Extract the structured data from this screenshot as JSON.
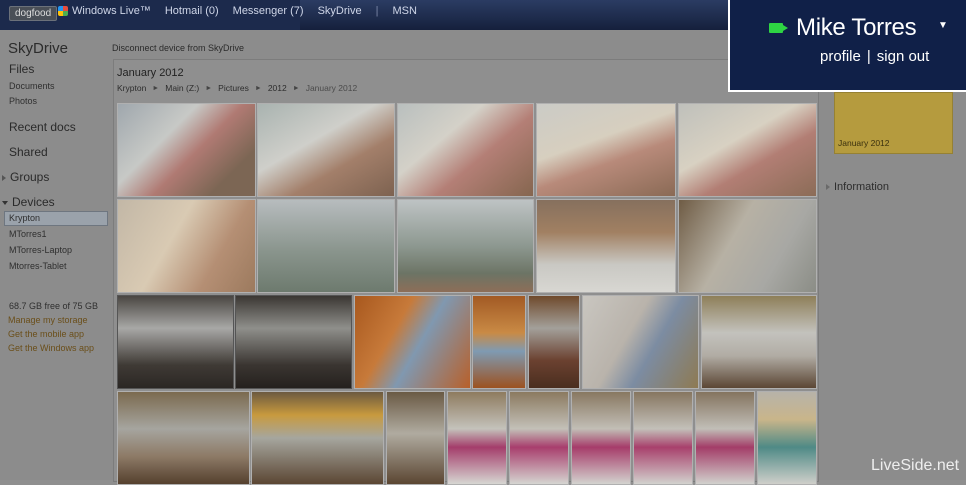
{
  "topnav": {
    "env_badge": "dogfood",
    "brand": "Windows Live™",
    "items": [
      "Hotmail (0)",
      "Messenger (7)",
      "SkyDrive",
      "|",
      "MSN"
    ]
  },
  "user": {
    "name": "Mike Torres",
    "profile": "profile",
    "signout": "sign out",
    "divider": "|"
  },
  "sidebar": {
    "title": "SkyDrive",
    "files": "Files",
    "files_items": [
      "Documents",
      "Photos"
    ],
    "recent": "Recent docs",
    "shared": "Shared",
    "groups": "Groups",
    "devices": "Devices",
    "device_items": [
      "Krypton",
      "MTorres1",
      "MTorres-Laptop",
      "Mtorres-Tablet"
    ],
    "storage": "68.7 GB free of 75 GB",
    "links": [
      "Manage my storage",
      "Get the mobile app",
      "Get the Windows app"
    ]
  },
  "content": {
    "disconnect": "Disconnect device from SkyDrive",
    "folder_title": "January 2012",
    "breadcrumb": [
      "Krypton",
      "Main (Z:)",
      "Pictures",
      "2012",
      "January 2012"
    ]
  },
  "right_panel": {
    "card_label": "January 2012",
    "information": "Information"
  },
  "watermark": "LiveSide.net",
  "colors": {
    "overlay_bg": "#102048",
    "messenger_icon": "#2ed443",
    "card": "#b59b3e"
  }
}
